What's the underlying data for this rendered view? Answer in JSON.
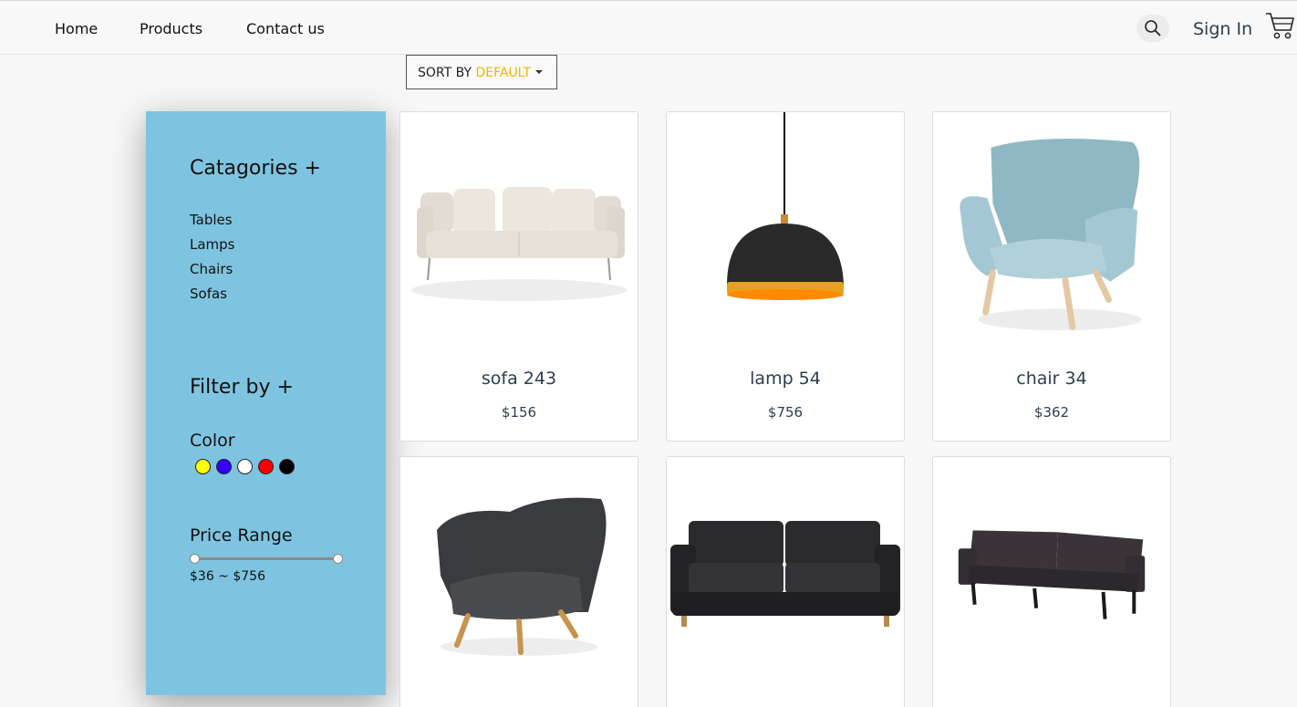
{
  "nav": {
    "links": [
      "Home",
      "Products",
      "Contact us"
    ],
    "signin_label": "Sign In",
    "search_icon": "search-icon",
    "cart_icon": "cart-icon"
  },
  "sort": {
    "prefix": "SORT BY ",
    "value": "DEFAULT",
    "value_color": "#f0b400"
  },
  "sidebar": {
    "background": "#7ec4e0",
    "categories_title": "Catagories +",
    "categories": [
      "Tables",
      "Lamps",
      "Chairs",
      "Sofas"
    ],
    "filter_title": "Filter by +",
    "color_label": "Color",
    "colors": [
      "#ffff00",
      "#3300ff",
      "#ffffff",
      "#ff0000",
      "#000000"
    ],
    "price_label": "Price Range",
    "price_min": 36,
    "price_max": 756,
    "price_text": "$36 ~ $756"
  },
  "products": [
    {
      "name": "sofa 243",
      "price": "$156",
      "image": "beige-sofa"
    },
    {
      "name": "lamp 54",
      "price": "$756",
      "image": "black-pendant-lamp"
    },
    {
      "name": "chair 34",
      "price": "$362",
      "image": "light-blue-armchair"
    },
    {
      "name": "",
      "price": "",
      "image": "dark-gray-armchair"
    },
    {
      "name": "",
      "price": "",
      "image": "black-sofa"
    },
    {
      "name": "",
      "price": "",
      "image": "dark-futon-sofa"
    }
  ]
}
